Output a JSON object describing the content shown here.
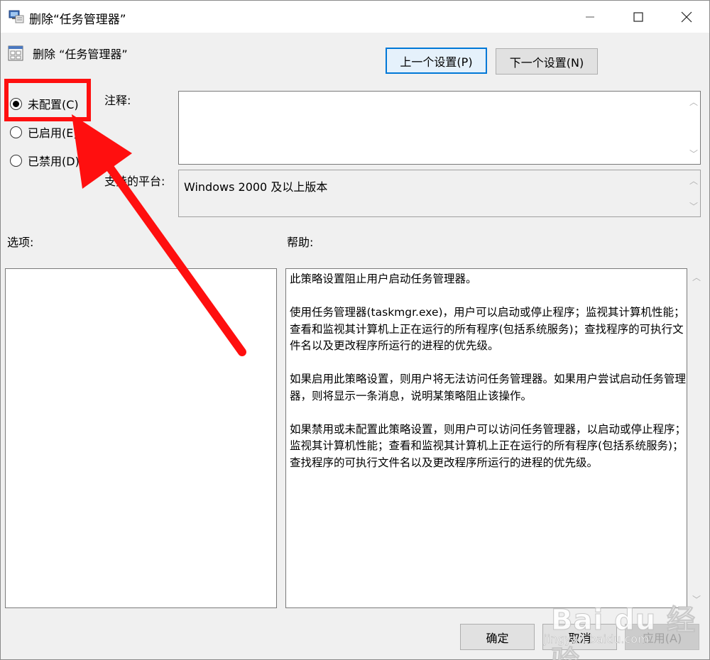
{
  "window": {
    "title": "删除“任务管理器”",
    "minimize_glyph": "—",
    "maximize_glyph": "□",
    "close_glyph": "✕"
  },
  "policy": {
    "title": "删除 “任务管理器”"
  },
  "nav": {
    "prev_label": "上一个设置(P)",
    "next_label": "下一个设置(N)"
  },
  "state": {
    "options": [
      {
        "label": "未配置(C)",
        "selected": true
      },
      {
        "label": "已启用(E)",
        "selected": false
      },
      {
        "label": "已禁用(D)",
        "selected": false
      }
    ]
  },
  "comment": {
    "label": "注释:",
    "value": ""
  },
  "supported": {
    "label": "支持的平台:",
    "value": "Windows 2000 及以上版本"
  },
  "options_panel": {
    "label": "选项:"
  },
  "help_panel": {
    "label": "帮助:",
    "paragraphs": [
      "此策略设置阻止用户启动任务管理器。",
      "使用任务管理器(taskmgr.exe)，用户可以启动或停止程序；监视其计算机性能；查看和监视其计算机上正在运行的所有程序(包括系统服务)；查找程序的可执行文件名以及更改程序所运行的进程的优先级。",
      "如果启用此策略设置，则用户将无法访问任务管理器。如果用户尝试启动任务管理器，则将显示一条消息，说明某策略阻止该操作。",
      "如果禁用或未配置此策略设置，则用户可以访问任务管理器，以启动或停止程序；监视其计算机性能；查看和监视其计算机上正在运行的所有程序(包括系统服务)；查找程序的可执行文件名以及更改程序所运行的进程的优先级。"
    ]
  },
  "footer": {
    "ok_label": "确定",
    "cancel_label": "取消",
    "apply_label": "应用(A)"
  },
  "watermark": {
    "brand": "Bai du 经验",
    "url": "jingyan.baidu.com"
  },
  "colors": {
    "annotation_red": "#ff0f0f",
    "focus_blue": "#0078d7"
  }
}
